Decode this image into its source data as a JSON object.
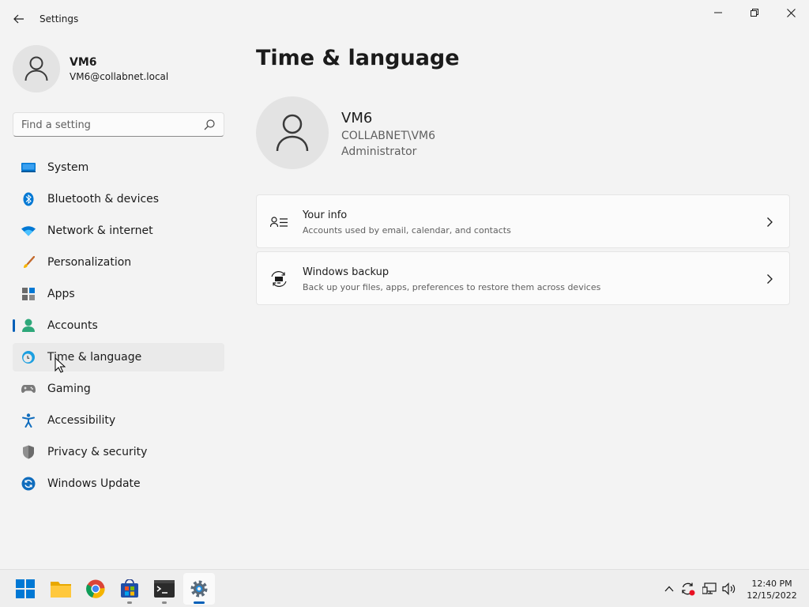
{
  "window": {
    "title": "Settings",
    "controls": [
      "minimize-icon",
      "maximize-icon",
      "close-icon"
    ]
  },
  "profile": {
    "name": "VM6",
    "email": "VM6@collabnet.local"
  },
  "search": {
    "placeholder": "Find a setting"
  },
  "sidebar": {
    "items": [
      {
        "label": "System",
        "icon": "system-icon"
      },
      {
        "label": "Bluetooth & devices",
        "icon": "bluetooth-icon"
      },
      {
        "label": "Network & internet",
        "icon": "wifi-icon"
      },
      {
        "label": "Personalization",
        "icon": "brush-icon"
      },
      {
        "label": "Apps",
        "icon": "apps-icon"
      },
      {
        "label": "Accounts",
        "icon": "accounts-icon"
      },
      {
        "label": "Time & language",
        "icon": "time-language-icon"
      },
      {
        "label": "Gaming",
        "icon": "gamepad-icon"
      },
      {
        "label": "Accessibility",
        "icon": "accessibility-icon"
      },
      {
        "label": "Privacy & security",
        "icon": "shield-icon"
      },
      {
        "label": "Windows Update",
        "icon": "windows-update-icon"
      }
    ]
  },
  "main": {
    "title": "Time & language",
    "user": {
      "name": "VM6",
      "domain": "COLLABNET\\VM6",
      "role": "Administrator"
    },
    "cards": [
      {
        "title": "Your info",
        "subtitle": "Accounts used by email, calendar, and contacts",
        "icon": "person-list-icon"
      },
      {
        "title": "Windows backup",
        "subtitle": "Back up your files, apps, preferences to restore them across devices",
        "icon": "backup-icon"
      }
    ]
  },
  "taskbar": {
    "apps": [
      "start-icon",
      "file-explorer-icon",
      "chrome-icon",
      "store-icon",
      "terminal-icon",
      "settings-icon"
    ],
    "tray": [
      "chevron-up-icon",
      "sync-icon",
      "network-icon",
      "volume-icon"
    ],
    "time": "12:40 PM",
    "date": "12/15/2022"
  },
  "colors": {
    "accent": "#005fb8",
    "background": "#f3f3f3",
    "card": "#fbfbfb"
  }
}
